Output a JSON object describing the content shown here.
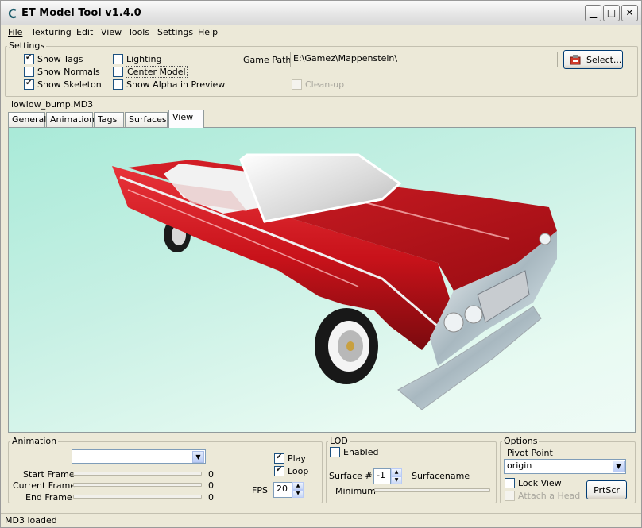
{
  "window": {
    "title": "ET Model Tool v1.4.0"
  },
  "menu": [
    "File",
    "Texturing",
    "Edit",
    "View",
    "Tools",
    "Settings",
    "Help"
  ],
  "settings": {
    "label": "Settings",
    "show_tags": "Show Tags",
    "show_normals": "Show Normals",
    "show_skeleton": "Show Skeleton",
    "lighting": "Lighting",
    "center_model": "Center Model",
    "show_alpha": "Show Alpha in Preview",
    "game_path_label": "Game Path",
    "game_path_value": "E:\\Gamez\\Mappenstein\\",
    "select_button": "Select...",
    "cleanup": "Clean-up"
  },
  "file_label": "lowlow_bump.MD3",
  "tabs": [
    "General",
    "Animation",
    "Tags",
    "Surfaces",
    "View"
  ],
  "active_tab": "View",
  "animation": {
    "label": "Animation",
    "start_frame": "Start Frame",
    "current_frame": "Current Frame",
    "end_frame": "End Frame",
    "start_value": "0",
    "current_value": "0",
    "end_value": "0",
    "play": "Play",
    "loop": "Loop",
    "fps_label": "FPS",
    "fps_value": "20"
  },
  "lod": {
    "label": "LOD",
    "enabled": "Enabled",
    "surface_label": "Surface #",
    "surface_value": "-1",
    "surfacename": "Surfacename",
    "minimum": "Minimum"
  },
  "options": {
    "label": "Options",
    "pivot_label": "Pivot Point",
    "pivot_value": "origin",
    "lock_view": "Lock View",
    "attach_head": "Attach a Head",
    "prtscr": "PrtScr"
  },
  "status": "MD3 loaded",
  "colors": {
    "car_body": "#c8121a",
    "viewport_bg": "#c7f0e4"
  }
}
